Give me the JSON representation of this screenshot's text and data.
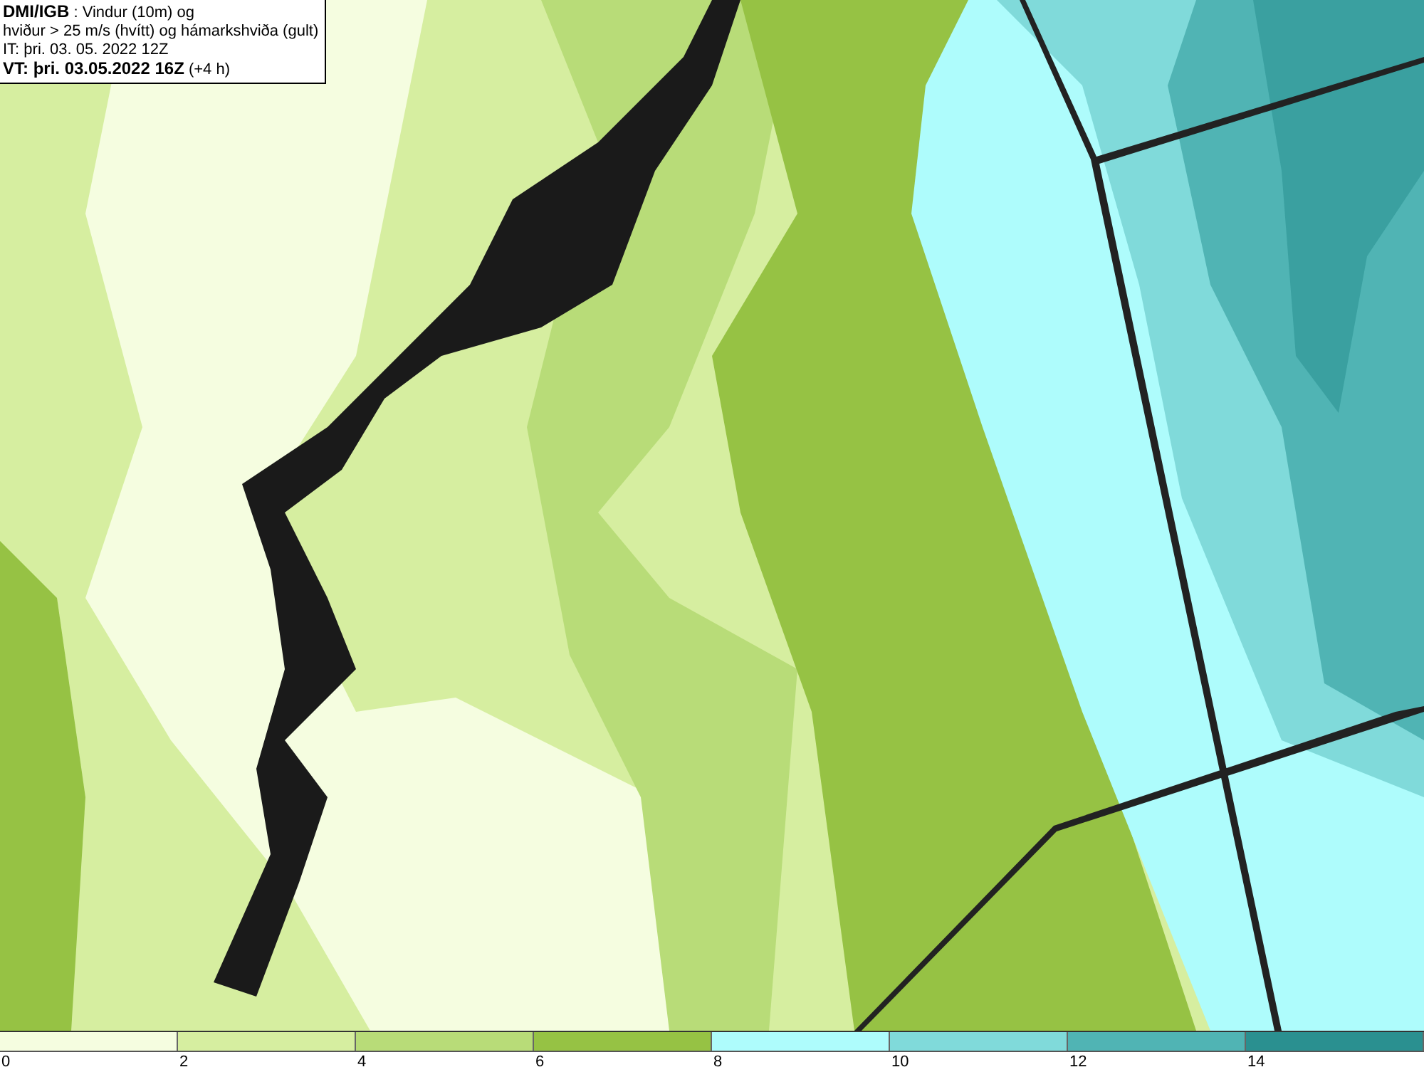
{
  "header": {
    "lines": [
      "**DMI/IGB** : Vindur (10m) og",
      "hviður > 25 m/s (hvítt) og hámarkshviða (gult)",
      "IT: þri. 03. 05. 2022 12Z",
      "**VT: þri. 03.05.2022 16Z** (+4 h)"
    ]
  },
  "legend": {
    "swatches": [
      {
        "color": "#f5fde0"
      },
      {
        "color": "#d6eea0"
      },
      {
        "color": "#b8dc78"
      },
      {
        "color": "#96c244"
      },
      {
        "color": "#aefcfc"
      },
      {
        "color": "#80dada"
      },
      {
        "color": "#50b4b4"
      },
      {
        "color": "#2a9090"
      }
    ],
    "ticks": [
      "0",
      "2",
      "4",
      "6",
      "8",
      "10",
      "12",
      "14"
    ]
  }
}
